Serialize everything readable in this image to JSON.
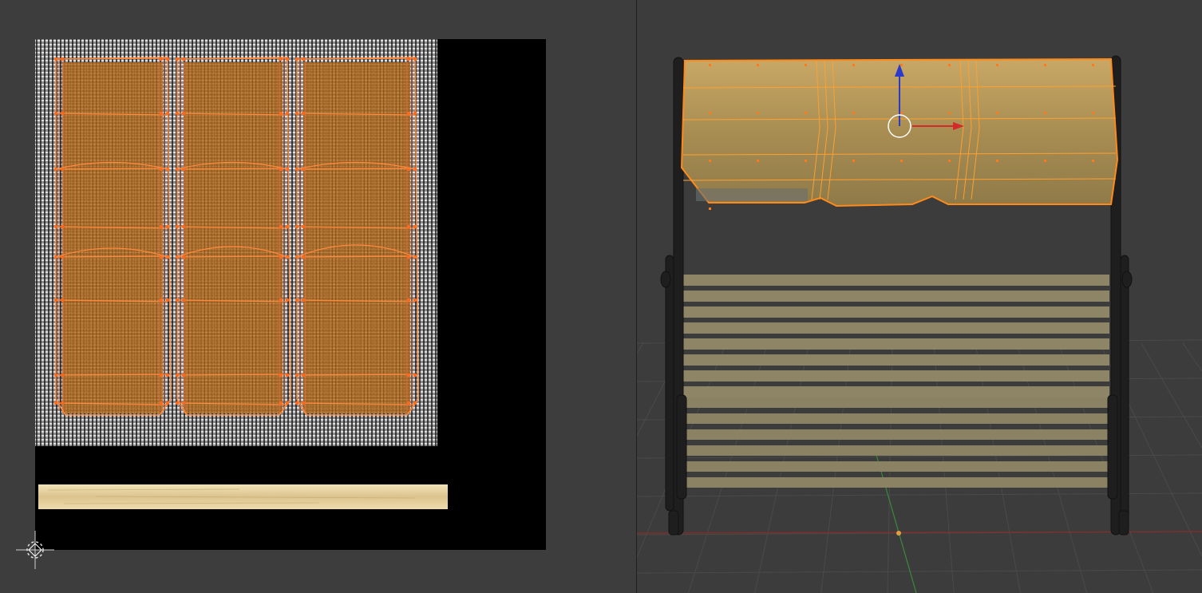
{
  "app": {
    "layout": "split-view",
    "panels": [
      "uv-image-editor",
      "3d-viewport"
    ]
  },
  "colors": {
    "editor_background": "#3d3d3d",
    "image_background": "#000000",
    "uv_selected": "#ff8a3d",
    "uv_vertex": "#ff6a1a",
    "cloth_texture": "#b06a22",
    "burlap_gray": "#8a8a8a",
    "wood_strip": "#e3cc98",
    "mesh_selected": "#b89650",
    "frame_dark": "#1e1e1e",
    "slat_color": "#8e8566",
    "axis_x": "#d42a2a",
    "axis_y": "#3a9a3a",
    "axis_z": "#2b3ac8",
    "grid_line": "#4a4a4a"
  },
  "uv_editor": {
    "image": "cloth-and-wood-texture-atlas",
    "selection": "uv-islands-selected",
    "cursor_icon": "2d-cursor-icon"
  },
  "viewport": {
    "object": "bench-swing-with-canopy",
    "selected_part": "canopy",
    "manipulator": "translate-gizmo",
    "grid": "floor-grid-visible"
  }
}
